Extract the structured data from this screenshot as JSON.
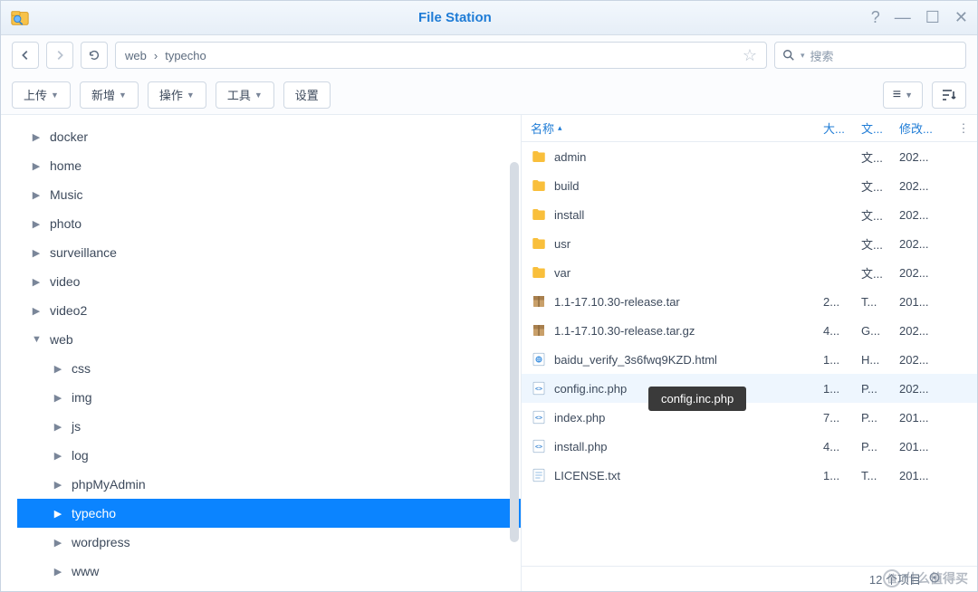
{
  "window": {
    "title": "File Station"
  },
  "path": {
    "segments": [
      "web",
      "typecho"
    ],
    "separator": "›"
  },
  "search": {
    "placeholder": "搜索",
    "caret": "▾"
  },
  "toolbar": {
    "upload": "上传",
    "create": "新增",
    "action": "操作",
    "tools": "工具",
    "settings": "设置"
  },
  "view": {
    "list_tip": "≡",
    "sort_tip": "≣"
  },
  "tree": {
    "items": [
      {
        "label": "docker",
        "depth": 0,
        "expanded": false
      },
      {
        "label": "home",
        "depth": 0,
        "expanded": false
      },
      {
        "label": "Music",
        "depth": 0,
        "expanded": false
      },
      {
        "label": "photo",
        "depth": 0,
        "expanded": false
      },
      {
        "label": "surveillance",
        "depth": 0,
        "expanded": false
      },
      {
        "label": "video",
        "depth": 0,
        "expanded": false
      },
      {
        "label": "video2",
        "depth": 0,
        "expanded": false
      },
      {
        "label": "web",
        "depth": 0,
        "expanded": true
      },
      {
        "label": "css",
        "depth": 1,
        "expanded": false
      },
      {
        "label": "img",
        "depth": 1,
        "expanded": false
      },
      {
        "label": "js",
        "depth": 1,
        "expanded": false
      },
      {
        "label": "log",
        "depth": 1,
        "expanded": false
      },
      {
        "label": "phpMyAdmin",
        "depth": 1,
        "expanded": false
      },
      {
        "label": "typecho",
        "depth": 1,
        "expanded": false,
        "selected": true
      },
      {
        "label": "wordpress",
        "depth": 1,
        "expanded": false
      },
      {
        "label": "www",
        "depth": 1,
        "expanded": false
      }
    ]
  },
  "columns": {
    "name": "名称",
    "size": "大...",
    "type": "文...",
    "modified": "修改...",
    "sort_arrow": "▴"
  },
  "files": [
    {
      "name": "admin",
      "icon": "folder",
      "size": "",
      "type": "文...",
      "modified": "202..."
    },
    {
      "name": "build",
      "icon": "folder",
      "size": "",
      "type": "文...",
      "modified": "202..."
    },
    {
      "name": "install",
      "icon": "folder",
      "size": "",
      "type": "文...",
      "modified": "202..."
    },
    {
      "name": "usr",
      "icon": "folder",
      "size": "",
      "type": "文...",
      "modified": "202..."
    },
    {
      "name": "var",
      "icon": "folder",
      "size": "",
      "type": "文...",
      "modified": "202..."
    },
    {
      "name": "1.1-17.10.30-release.tar",
      "icon": "archive",
      "size": "2...",
      "type": "T...",
      "modified": "201..."
    },
    {
      "name": "1.1-17.10.30-release.tar.gz",
      "icon": "archive",
      "size": "4...",
      "type": "G...",
      "modified": "202..."
    },
    {
      "name": "baidu_verify_3s6fwq9KZD.html",
      "icon": "html",
      "size": "1...",
      "type": "H...",
      "modified": "202..."
    },
    {
      "name": "config.inc.php",
      "icon": "php",
      "size": "1...",
      "type": "P...",
      "modified": "202...",
      "highlighted": true
    },
    {
      "name": "index.php",
      "icon": "php",
      "size": "7...",
      "type": "P...",
      "modified": "201..."
    },
    {
      "name": "install.php",
      "icon": "php",
      "size": "4...",
      "type": "P...",
      "modified": "201..."
    },
    {
      "name": "LICENSE.txt",
      "icon": "txt",
      "size": "1...",
      "type": "T...",
      "modified": "201..."
    }
  ],
  "tooltip": {
    "text": "config.inc.php"
  },
  "footer": {
    "count": "12 个项目"
  },
  "watermark": {
    "text": "什么值得买"
  }
}
